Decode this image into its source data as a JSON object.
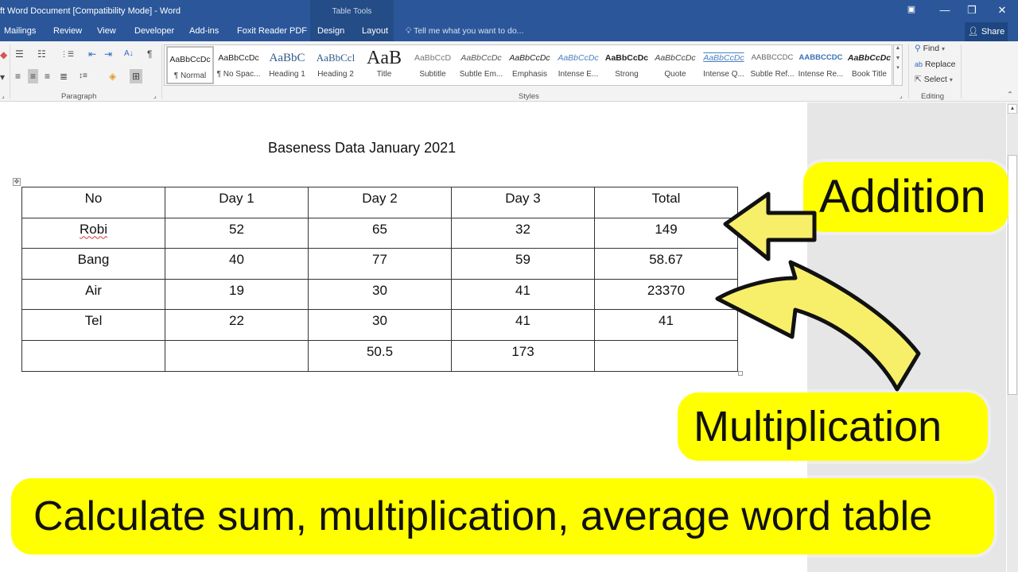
{
  "window": {
    "title": "ft Word Document [Compatibility Mode] - Word",
    "contextual_group": "Table Tools",
    "controls": {
      "ribbon_display": "▣",
      "minimize": "—",
      "restore": "❐",
      "close": "✕"
    }
  },
  "tabs": [
    {
      "label": "Mailings"
    },
    {
      "label": "Review"
    },
    {
      "label": "View"
    },
    {
      "label": "Developer"
    },
    {
      "label": "Add-ins"
    },
    {
      "label": "Foxit Reader PDF"
    },
    {
      "label": "Design"
    },
    {
      "label": "Layout"
    }
  ],
  "tell_me": {
    "icon": "lightbulb-icon",
    "placeholder": "Tell me what you want to do..."
  },
  "share": {
    "label": "Share",
    "icon": "person-add-icon"
  },
  "ribbon": {
    "paragraph": {
      "label": "Paragraph",
      "icons": {
        "bullets": "☰",
        "numbering": "☷",
        "multilevel": "⋮☰",
        "decrease_indent": "⇤",
        "increase_indent": "⇥",
        "sort": "A↓",
        "pilcrow": "¶",
        "align_left": "≡",
        "center": "≡",
        "align_right": "≡",
        "justify": "≣",
        "line_spacing": "↕≡",
        "shading": "◈",
        "borders": "⊞",
        "dropdown": "▾"
      }
    },
    "styles": {
      "label": "Styles",
      "items": [
        {
          "preview": "AaBbCcDc",
          "label": "¶ Normal"
        },
        {
          "preview": "AaBbCcDc",
          "label": "¶ No Spac..."
        },
        {
          "preview": "AaBbC",
          "label": "Heading 1"
        },
        {
          "preview": "AaBbCcl",
          "label": "Heading 2"
        },
        {
          "preview": "AaB",
          "label": "Title"
        },
        {
          "preview": "AaBbCcD",
          "label": "Subtitle"
        },
        {
          "preview": "AaBbCcDc",
          "label": "Subtle Em..."
        },
        {
          "preview": "AaBbCcDc",
          "label": "Emphasis"
        },
        {
          "preview": "AaBbCcDc",
          "label": "Intense E..."
        },
        {
          "preview": "AaBbCcDc",
          "label": "Strong"
        },
        {
          "preview": "AaBbCcDc",
          "label": "Quote"
        },
        {
          "preview": "AaBbCcDc",
          "label": "Intense Q..."
        },
        {
          "preview": "AABBCCDC",
          "label": "Subtle Ref..."
        },
        {
          "preview": "AABBCCDC",
          "label": "Intense Re..."
        },
        {
          "preview": "AaBbCcDc",
          "label": "Book Title"
        }
      ]
    },
    "editing": {
      "label": "Editing",
      "find": "Find",
      "replace": "Replace",
      "select": "Select"
    }
  },
  "document": {
    "title": "Baseness Data January 2021",
    "table": {
      "headers": [
        "No",
        "Day 1",
        "Day 2",
        "Day 3",
        "Total"
      ],
      "rows": [
        [
          "Robi",
          "52",
          "65",
          "32",
          "149"
        ],
        [
          "Bang",
          "40",
          "77",
          "59",
          "58.67"
        ],
        [
          "Air",
          "19",
          "30",
          "41",
          "23370"
        ],
        [
          "Tel",
          "22",
          "30",
          "41",
          "41"
        ],
        [
          "",
          "",
          "50.5",
          "173",
          ""
        ]
      ]
    }
  },
  "overlays": {
    "addition": "Addition",
    "multiplication": "Multiplication",
    "caption": "Calculate sum, multiplication, average word table",
    "highlight_color": "#ffff00",
    "arrow_fill": "#f7ef6a"
  },
  "colors": {
    "titlebar": "#2b579a",
    "contextual": "#244c87",
    "ribbon": "#f3f3f3",
    "canvas": "#e6e6e6"
  }
}
